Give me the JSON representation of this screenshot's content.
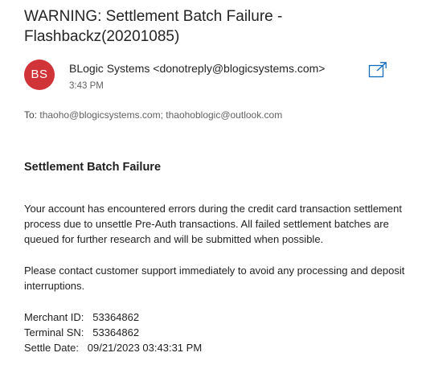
{
  "email": {
    "subject": "WARNING: Settlement Batch Failure - Flashbackz(20201085)",
    "sender": {
      "initials": "BS",
      "display": "BLogic Systems <donotreply@blogicsystems.com>",
      "avatar_color": "#d13438"
    },
    "time": "3:43 PM",
    "to_label": "To:",
    "recipients": "thaoho@blogicsystems.com; thaohoblogic@outlook.com",
    "popout_icon": "open-in-new-window-icon",
    "body": {
      "heading": "Settlement Batch Failure",
      "paragraph1": "Your account has encountered errors during the credit card transaction settlement process due to unsettle Pre-Auth transactions. All failed settlement batches are queued for further research and will be submitted when possible.",
      "paragraph2": "Please contact customer support immediately to avoid any processing and deposit interruptions.",
      "merchant_id": "Merchant ID:   53364862",
      "terminal_sn": "Terminal SN:   53364862",
      "settle_date": "Settle Date:   09/21/2023 03:43:31 PM"
    }
  }
}
